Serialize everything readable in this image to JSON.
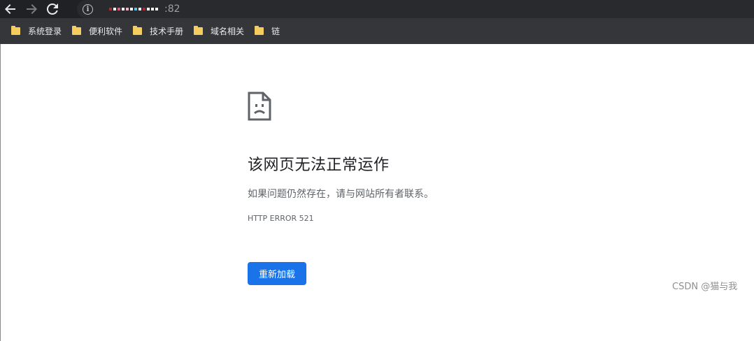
{
  "browser": {
    "url_suffix": ":82",
    "nav": {
      "back_icon": "arrow-left-icon",
      "forward_icon": "arrow-right-icon",
      "reload_icon": "reload-icon",
      "site_info_icon": "info-icon"
    }
  },
  "bookmarks": [
    {
      "label": "系统登录"
    },
    {
      "label": "便利软件"
    },
    {
      "label": "技术手册"
    },
    {
      "label": "域名相关"
    },
    {
      "label": "链"
    }
  ],
  "error_page": {
    "icon": "sad-page-icon",
    "title": "该网页无法正常运作",
    "description": "如果问题仍然存在，请与网站所有者联系。",
    "code": "HTTP ERROR 521",
    "reload_label": "重新加载"
  },
  "watermark": "CSDN @猫与我",
  "colors": {
    "toolbar_bg": "#202124",
    "bookmarks_bg": "#35363a",
    "folder": "#f5cd5f",
    "primary_button": "#1a73e8"
  }
}
